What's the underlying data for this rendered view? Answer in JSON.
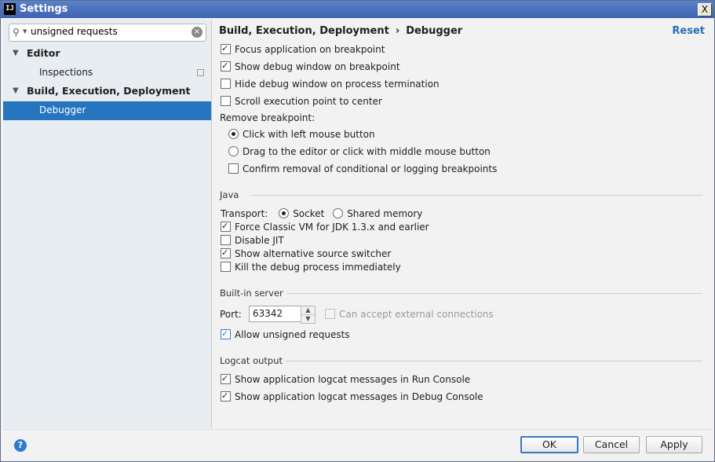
{
  "window": {
    "app_icon": "IJ",
    "title": "Settings",
    "close_label": "X"
  },
  "sidebar": {
    "search_value": "unsigned requests",
    "items": [
      {
        "label": "Editor"
      },
      {
        "label": "Inspections"
      },
      {
        "label": "Build, Execution, Deployment"
      },
      {
        "label": "Debugger"
      }
    ]
  },
  "header": {
    "crumb1": "Build, Execution, Deployment",
    "sep": "›",
    "crumb2": "Debugger",
    "reset": "Reset"
  },
  "general": {
    "focus_app": "Focus application on breakpoint",
    "show_debug_window": "Show debug window on breakpoint",
    "hide_debug_window": "Hide debug window on process termination",
    "scroll_exec": "Scroll execution point to center",
    "remove_bp_label": "Remove breakpoint:",
    "click_left": "Click with left mouse button",
    "drag_editor": "Drag to the editor or click with middle mouse button",
    "confirm_removal": "Confirm removal of conditional or logging breakpoints"
  },
  "java": {
    "section": "Java",
    "transport_label": "Transport:",
    "socket": "Socket",
    "shared_memory": "Shared memory",
    "force_classic": "Force Classic VM for JDK 1.3.x and earlier",
    "disable_jit": "Disable JIT",
    "show_alt_source": "Show alternative source switcher",
    "kill_process": "Kill the debug process immediately"
  },
  "builtin": {
    "section": "Built-in server",
    "port_label": "Port:",
    "port_value": "63342",
    "can_accept": "Can accept external connections",
    "allow_unsigned": "Allow unsigned requests"
  },
  "logcat": {
    "section": "Logcat output",
    "run_console": "Show application logcat messages in Run Console",
    "debug_console": "Show application logcat messages in Debug Console"
  },
  "footer": {
    "help": "?",
    "ok": "OK",
    "cancel": "Cancel",
    "apply": "Apply"
  }
}
